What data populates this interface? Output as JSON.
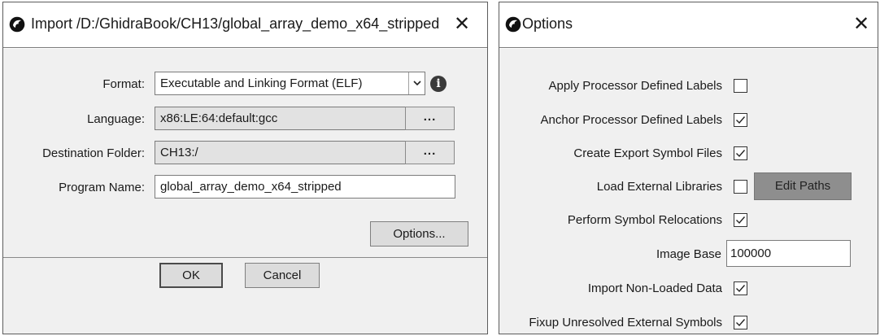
{
  "import_dialog": {
    "title": "Import /D:/GhidraBook/CH13/global_array_demo_x64_stripped",
    "close_glyph": "✕",
    "icon": "ghidra-logo-icon",
    "format": {
      "label": "Format:",
      "value": "Executable and Linking Format (ELF)",
      "info_glyph": "i"
    },
    "language": {
      "label": "Language:",
      "value": "x86:LE:64:default:gcc",
      "browse_label": "..."
    },
    "destination": {
      "label": "Destination Folder:",
      "value": "CH13:/",
      "browse_label": "..."
    },
    "program_name": {
      "label": "Program Name:",
      "value": "global_array_demo_x64_stripped"
    },
    "options_button": "Options...",
    "ok_button": "OK",
    "cancel_button": "Cancel"
  },
  "options_dialog": {
    "title": "Options",
    "close_glyph": "✕",
    "icon": "ghidra-logo-icon",
    "items": [
      {
        "label": "Apply Processor Defined Labels",
        "checked": false
      },
      {
        "label": "Anchor Processor Defined Labels",
        "checked": true
      },
      {
        "label": "Create Export Symbol Files",
        "checked": true
      },
      {
        "label": "Load External Libraries",
        "checked": false
      },
      {
        "label": "Perform Symbol Relocations",
        "checked": true
      },
      {
        "label": "Import Non-Loaded Data",
        "checked": true
      },
      {
        "label": "Fixup Unresolved External Symbols",
        "checked": true
      }
    ],
    "edit_paths_button": "Edit Paths",
    "image_base": {
      "label": "Image Base",
      "value": "100000"
    }
  },
  "colors": {
    "dialog_body": "#f0f0f0",
    "readonly_field": "#e2e2e2",
    "edit_paths_disabled": "#8e8e8e"
  }
}
